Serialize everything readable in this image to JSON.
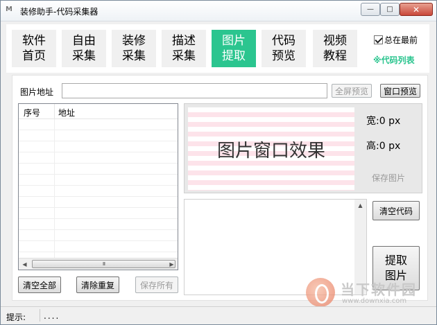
{
  "window": {
    "app_icon": "M",
    "title": "装修助手-代码采集器",
    "minimize_symbol": "—",
    "maximize_symbol": "□",
    "close_symbol": "✕"
  },
  "nav": {
    "tabs": [
      {
        "line1": "软件",
        "line2": "首页"
      },
      {
        "line1": "自由",
        "line2": "采集"
      },
      {
        "line1": "装修",
        "line2": "采集"
      },
      {
        "line1": "描述",
        "line2": "采集"
      },
      {
        "line1": "图片",
        "line2": "提取"
      },
      {
        "line1": "代码",
        "line2": "预览"
      },
      {
        "line1": "视频",
        "line2": "教程"
      }
    ],
    "active_tab": "图片提取",
    "accent_color": "#2bc58f",
    "topmost_label": "总在最前",
    "topmost_checked": true,
    "code_list_link": "※代码列表"
  },
  "address": {
    "label": "图片地址",
    "value": "",
    "fullscreen_button": "全屏预览",
    "window_button": "窗口预览"
  },
  "list": {
    "columns": [
      "序号",
      "地址"
    ],
    "rows": [],
    "scroll_thumb": "III"
  },
  "preview": {
    "effect_text": "图片窗口效果",
    "width_text": "宽:0 px",
    "height_text": "高:0 px",
    "save_image": "保存图片"
  },
  "buttons": {
    "clear_all": "清空全部",
    "remove_duplicates": "清除重复",
    "save_all": "保存所有",
    "clear_code": "清空代码",
    "extract_line1": "提取",
    "extract_line2": "图片"
  },
  "status": {
    "label": "提示:",
    "value": "...."
  },
  "watermark": {
    "text": "当下软件园",
    "url": "www.downxia.com"
  }
}
